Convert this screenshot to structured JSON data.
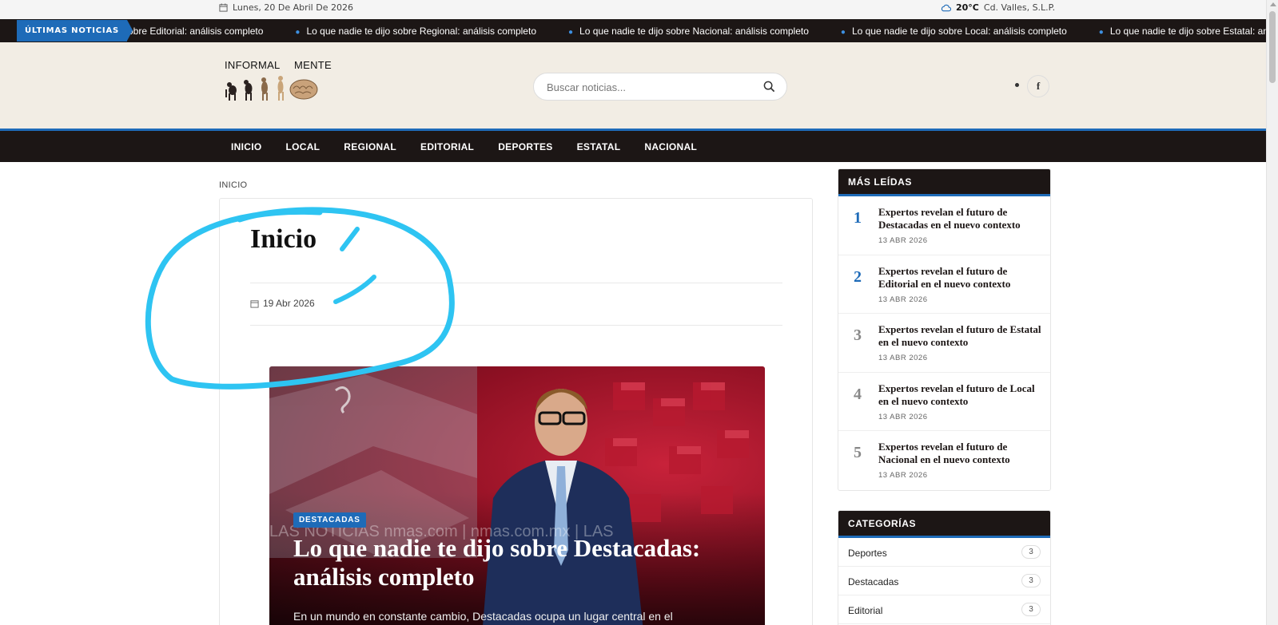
{
  "topbar": {
    "date": "Lunes, 20 De Abril De 2026",
    "temperature": "20°C",
    "location": "Cd. Valles, S.L.P."
  },
  "ticker": {
    "label": "ÚLTIMAS NOTICIAS",
    "first_fragment": "obre Editorial: análisis completo",
    "items": [
      "Lo que nadie te dijo sobre Regional: análisis completo",
      "Lo que nadie te dijo sobre Nacional: análisis completo",
      "Lo que nadie te dijo sobre Local: análisis completo",
      "Lo que nadie te dijo sobre Estatal: análisis completo"
    ]
  },
  "header": {
    "logo_text": "INFORMAL MENTE",
    "search_placeholder": "Buscar noticias...",
    "facebook_glyph": "f"
  },
  "nav": {
    "items": [
      "INICIO",
      "LOCAL",
      "REGIONAL",
      "EDITORIAL",
      "DEPORTES",
      "ESTATAL",
      "NACIONAL"
    ]
  },
  "breadcrumb": "INICIO",
  "main": {
    "title": "Inicio",
    "date": "19 Abr 2026",
    "feature": {
      "category": "DESTACADAS",
      "title": "Lo que nadie te dijo sobre Destacadas: análisis completo",
      "excerpt": "En un mundo en constante cambio, Destacadas ocupa un lugar central en el",
      "image_caption": "LAS NOTICIAS  nmas.com  |  nmas.com.mx  |  LAS"
    }
  },
  "sidebar": {
    "popular": {
      "title": "MÁS LEÍDAS",
      "items": [
        {
          "num": "1",
          "title": "Expertos revelan el futuro de Destacadas en el nuevo contexto",
          "date": "13 ABR 2026"
        },
        {
          "num": "2",
          "title": "Expertos revelan el futuro de Editorial en el nuevo contexto",
          "date": "13 ABR 2026"
        },
        {
          "num": "3",
          "title": "Expertos revelan el futuro de Estatal en el nuevo contexto",
          "date": "13 ABR 2026"
        },
        {
          "num": "4",
          "title": "Expertos revelan el futuro de Local en el nuevo contexto",
          "date": "13 ABR 2026"
        },
        {
          "num": "5",
          "title": "Expertos revelan el futuro de Nacional en el nuevo contexto",
          "date": "13 ABR 2026"
        }
      ]
    },
    "categories": {
      "title": "CATEGORÍAS",
      "items": [
        {
          "name": "Deportes",
          "count": "3"
        },
        {
          "name": "Destacadas",
          "count": "3"
        },
        {
          "name": "Editorial",
          "count": "3"
        }
      ]
    }
  },
  "colors": {
    "accent": "#1e6bb8",
    "dark": "#1c1615",
    "header_bg": "#f2ede4",
    "annotation": "#2ec4f2",
    "rank_top": "#1e6bb8",
    "rank_other": "#888888"
  }
}
